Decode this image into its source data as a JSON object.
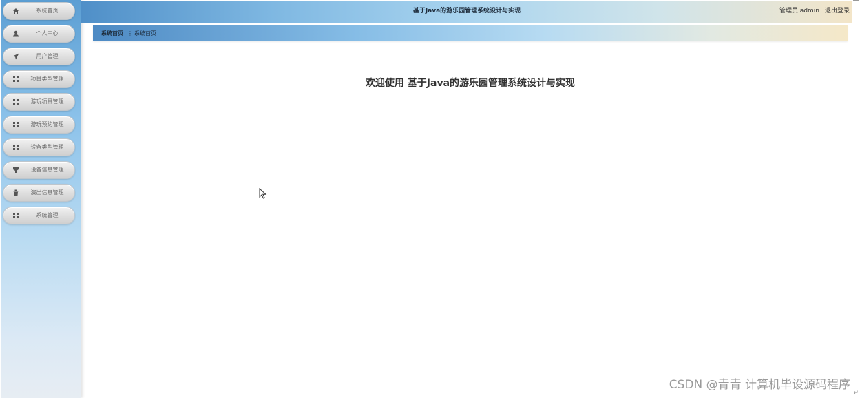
{
  "header": {
    "title": "基于Java的游乐园管理系统设计与实现",
    "user_label": "管理员 admin",
    "logout_label": "退出登录"
  },
  "sidebar": {
    "items": [
      {
        "label": "系统首页",
        "icon": "home-icon"
      },
      {
        "label": "个人中心",
        "icon": "user-icon"
      },
      {
        "label": "用户管理",
        "icon": "send-icon"
      },
      {
        "label": "项目类型管理",
        "icon": "grid-icon"
      },
      {
        "label": "游玩项目管理",
        "icon": "grid-icon"
      },
      {
        "label": "游玩预约管理",
        "icon": "grid-icon"
      },
      {
        "label": "设备类型管理",
        "icon": "grid-icon"
      },
      {
        "label": "设备信息管理",
        "icon": "filter-icon"
      },
      {
        "label": "演出信息管理",
        "icon": "trash-icon"
      },
      {
        "label": "系统管理",
        "icon": "grid-icon"
      }
    ]
  },
  "breadcrumb": {
    "home": "系统首页",
    "separator": "⋮",
    "current": "系统首页"
  },
  "main": {
    "welcome": "欢迎使用 基于Java的游乐园管理系统设计与实现"
  },
  "watermark": "CSDN @青青  计算机毕设源码程序",
  "colors": {
    "sidebar_top": "#5b9ed3",
    "header_start": "#4f8fc8",
    "header_end": "#f3e5c8",
    "menu_button": "#dcdcdc"
  }
}
